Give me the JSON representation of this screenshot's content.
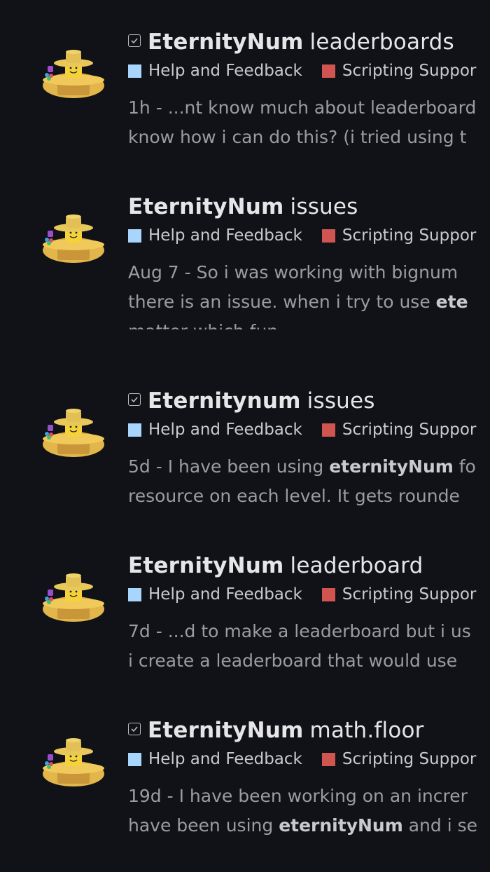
{
  "colors": {
    "background": "#111217",
    "help_feedback": "#a7d5fb",
    "scripting_support": "#d0544f"
  },
  "results": [
    {
      "solved": true,
      "title_main": "EternityNum",
      "title_rest": "leaderboards",
      "category": "Help and Feedback",
      "subcategory": "Scripting Suppor",
      "date": "1h",
      "line1_pre": "...nt know much about leaderboard",
      "line1_bold": "",
      "line1_post": "",
      "line2_pre": "know how i can do this? (i tried using t",
      "line2_bold": "",
      "line2_post": "",
      "line3": ""
    },
    {
      "solved": false,
      "title_main": "EternityNum",
      "title_rest": "issues",
      "category": "Help and Feedback",
      "subcategory": "Scripting Suppor",
      "date": "Aug 7",
      "line1_pre": "So i was working with bignum",
      "line1_bold": "",
      "line1_post": "",
      "line2_pre": "there is an issue. when i try to use",
      "line2_bold": "ete",
      "line2_post": "",
      "line3": "matter which fun..."
    },
    {
      "solved": true,
      "title_main": "Eternitynum",
      "title_rest": "issues",
      "category": "Help and Feedback",
      "subcategory": "Scripting Suppor",
      "date": "5d",
      "line1_pre": "I have been using",
      "line1_bold": "eternityNum",
      "line1_post": "fo",
      "line2_pre": "resource on each level. It gets rounde",
      "line2_bold": "",
      "line2_post": "",
      "line3": ""
    },
    {
      "solved": false,
      "title_main": "EternityNum",
      "title_rest": "leaderboard",
      "category": "Help and Feedback",
      "subcategory": "Scripting Suppor",
      "date": "7d",
      "line1_pre": "...d to make a leaderboard but i us",
      "line1_bold": "",
      "line1_post": "",
      "line2_pre": "i create a leaderboard that would use",
      "line2_bold": "",
      "line2_post": "",
      "line3": ""
    },
    {
      "solved": true,
      "title_main": "EternityNum",
      "title_rest": "math.floor",
      "category": "Help and Feedback",
      "subcategory": "Scripting Suppor",
      "date": "19d",
      "line1_pre": "I have been working on an increr",
      "line1_bold": "",
      "line1_post": "",
      "line2_pre": "have been using",
      "line2_bold": "eternityNum",
      "line2_post": "and i se",
      "line3": ""
    }
  ]
}
